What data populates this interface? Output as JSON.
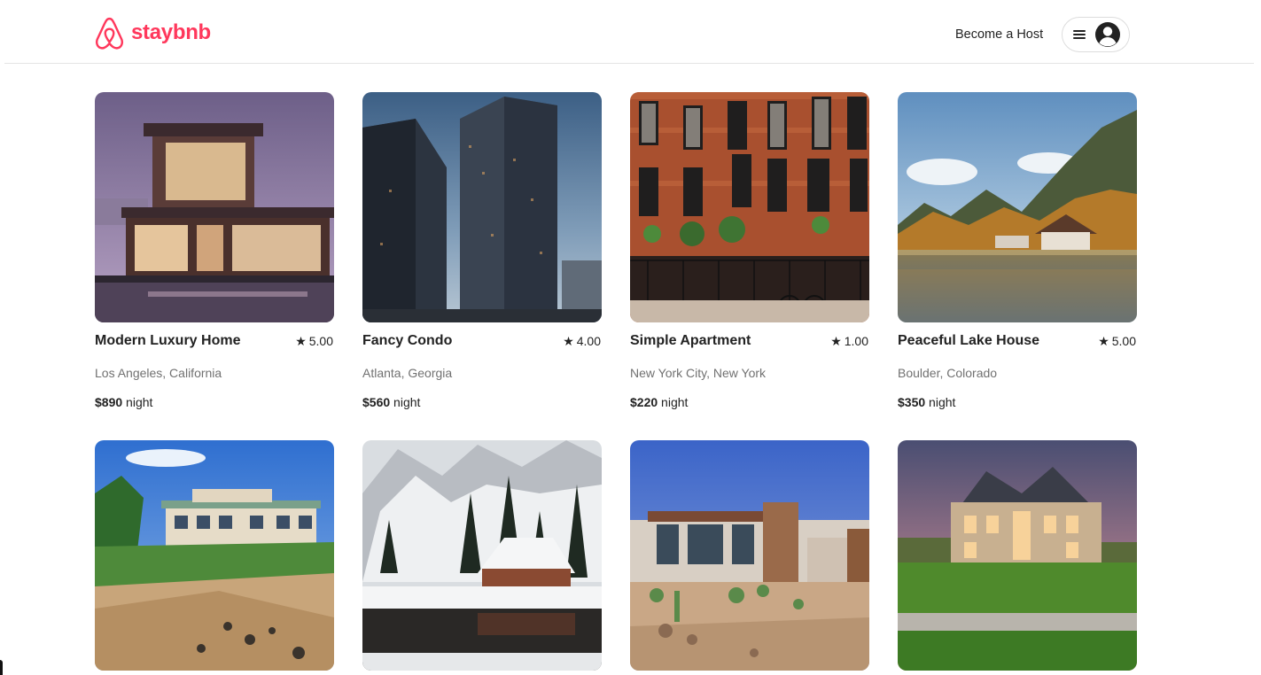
{
  "brand": {
    "name": "staybnb",
    "color": "#ff385c"
  },
  "header": {
    "host_link": "Become a Host",
    "menu_icon": "hamburger-menu-icon",
    "avatar_icon": "user-avatar-icon"
  },
  "listings": [
    {
      "title": "Modern Luxury Home",
      "rating": "5.00",
      "location": "Los Angeles, California",
      "price": "$890",
      "unit": "night"
    },
    {
      "title": "Fancy Condo",
      "rating": "4.00",
      "location": "Atlanta, Georgia",
      "price": "$560",
      "unit": "night"
    },
    {
      "title": "Simple Apartment",
      "rating": "1.00",
      "location": "New York City, New York",
      "price": "$220",
      "unit": "night"
    },
    {
      "title": "Peaceful Lake House",
      "rating": "5.00",
      "location": "Boulder, Colorado",
      "price": "$350",
      "unit": "night"
    }
  ],
  "icons": {
    "star": "★",
    "star_name": "star-icon"
  }
}
